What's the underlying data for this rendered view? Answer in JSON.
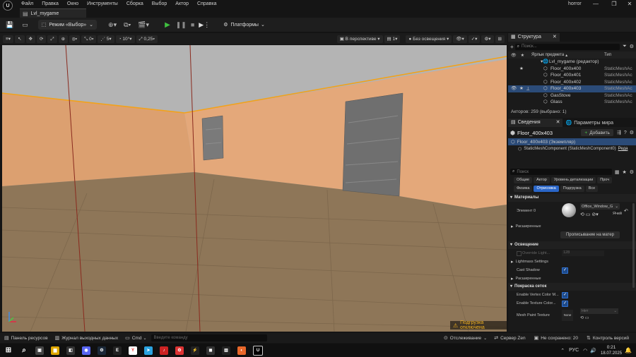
{
  "menu": {
    "items": [
      "Файл",
      "Правка",
      "Окно",
      "Инструменты",
      "Сборка",
      "Выбор",
      "Актор",
      "Справка"
    ],
    "window_title": "horror"
  },
  "level_tab": {
    "label": "Lvl_mygame"
  },
  "toolbar": {
    "mode_label": "Режим «Выбор»",
    "platforms_label": "Платформы"
  },
  "viewport_toolbar": {
    "rotate_snap": "0",
    "grid_snap": "5",
    "angle_snap": "10°",
    "scale_snap": "0,25",
    "perspective_label": "В перспективе",
    "lighting_label": "Без освещения",
    "camera_speed": "1"
  },
  "viewport": {
    "streaming_notice": "Подгрузка отключена"
  },
  "outliner": {
    "tab_label": "Структура",
    "search_placeholder": "Поиск...",
    "col_label": "Ярлык предмета",
    "col_type": "Тип",
    "root": "Lvl_mygame (редактор)",
    "rows": [
      {
        "name": "Floor_400x400",
        "type": "StaticMeshAc"
      },
      {
        "name": "Floor_400x401",
        "type": "StaticMeshAc"
      },
      {
        "name": "Floor_400x402",
        "type": "StaticMeshAc"
      },
      {
        "name": "Floor_400x403",
        "type": "StaticMeshAc",
        "selected": true
      },
      {
        "name": "GasStove",
        "type": "StaticMeshAc"
      },
      {
        "name": "Glass",
        "type": "StaticMeshAc"
      }
    ],
    "actor_count": "Акторов: 259 (выбрано: 1)"
  },
  "details": {
    "tab_label": "Сведения",
    "world_tab_label": "Параметры мира",
    "actor_name": "Floor_400x403",
    "add_button": "Добавить",
    "instance_label": "Floor_400x403 (Экземпляр)",
    "component_label": "StaticMeshComponent (StaticMeshComponent0)",
    "edit_link": "Реда",
    "search_placeholder": "Поиск",
    "categories_row1": [
      "Общие",
      "Актор",
      "Уровень детализации",
      "Проч"
    ],
    "categories_row2": [
      "Физика",
      "Отрисовка",
      "Подгрузка",
      "Все"
    ],
    "active_category": "Отрисовка",
    "materials_header": "Материалы",
    "element_label": "Элемент 0",
    "material_name": "Office_Window_G",
    "material_extra": "Ячей",
    "advanced_label": "Расширенные",
    "assign_button": "Прописывание на матер",
    "lighting_header": "Освещение",
    "override_light_label": "Override Light...",
    "override_light_value": "128",
    "lightmass_label": "Lightmass Settings",
    "cast_shadow_label": "Cast Shadow",
    "advanced_label2": "Расширенные",
    "mesh_paint_header": "Покраска сеток",
    "vertex_color_label": "Enable Vertex Color M...",
    "texture_color_label": "Enable Texture Color...",
    "mesh_paint_texture_label": "Mesh Paint Texture",
    "mesh_paint_value": "Нет",
    "mesh_paint_thumb": "None"
  },
  "statusbar": {
    "content_browser": "Панель ресурсов",
    "output_log": "Журнал выходных данных",
    "cmd_label": "Cmd",
    "cmd_placeholder": "Введите команду",
    "tracking": "Отслеживание",
    "server": "Сервер Zen",
    "unsaved": "Не сохранено: 20",
    "source_control": "Контроль версий"
  },
  "taskbar": {
    "language": "РУС",
    "time": "0:21",
    "date": "18.07.2025"
  },
  "colors": {
    "accent": "#2a66c8",
    "selection": "#2b4b78",
    "wall": "#e3a87a",
    "ceiling": "#b8b8b8",
    "floor": "#8a7458"
  }
}
